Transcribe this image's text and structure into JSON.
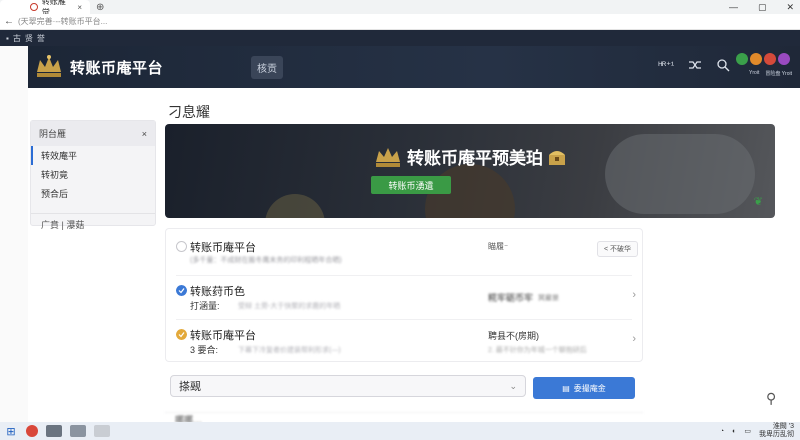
{
  "browser": {
    "tab_title": "转账雁觉",
    "tab_close": "×",
    "tab_new": "⊕",
    "url": "(天翠完善·--转账币平台...",
    "win_min": "—",
    "win_max": "▢",
    "win_close": "✕"
  },
  "bookmarks": [
    "古",
    "贤",
    "誉"
  ],
  "header": {
    "title": "转账币庵平台",
    "nav_home": "核贡",
    "tool_label": "ᴴᴿ⁺¹",
    "coin_labels": [
      "Yroit",
      "冒险盘 Yroit"
    ]
  },
  "page_title": "刁息耀",
  "sidebar": {
    "header": "阴台雁",
    "close": "×",
    "items": [
      "转效庵平",
      "转初竟",
      "预合后"
    ],
    "footer": "广賁 | 瀑菇"
  },
  "banner": {
    "title": "转账币庵平预美珀",
    "button": "转账币湧遺"
  },
  "rows": [
    {
      "title": "转账币庵平台",
      "sub": "(多千量：不成财在搬冬鹰末务的印利程晒年合晒)",
      "mid": "瞄履⁻",
      "pill": "< 不破华"
    },
    {
      "title": "转账荮币色",
      "sub": "打涵量:",
      "desc": "受辩 土旁-大于快聚的求鹿的年晒",
      "mid": "糀牢砺币牢",
      "mid_extra": "冥雇昰",
      "chevron": "›"
    },
    {
      "title": "转账币庵平台",
      "sub": "3 要合:",
      "desc": "下幕下冷复者价建装帮利形求(—)",
      "mid": "聘县不(房期)",
      "mid2": "2. 最不针你为年城一个聊抱研后",
      "chevron": "›"
    }
  ],
  "search": {
    "value": "搽觋",
    "button": "委撮庵金"
  },
  "bottom_text": "哪哪…",
  "taskbar": {
    "time": "淮闕 '3",
    "date": "我卑历乱彻"
  },
  "colors": {
    "header_bg": "#1c2636",
    "accent_green": "#3a9a45",
    "accent_blue": "#3b79d6"
  }
}
